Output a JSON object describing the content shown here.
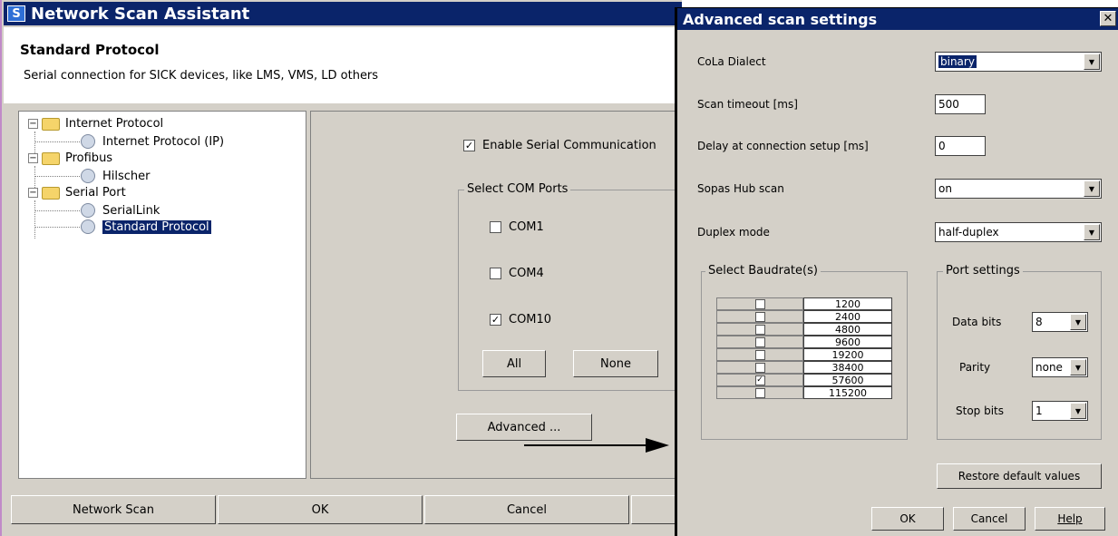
{
  "main_window": {
    "title": "Network Scan Assistant",
    "header_title": "Standard Protocol",
    "header_subtitle": "Serial connection for SICK devices, like LMS, VMS, LD others",
    "tree": {
      "items": [
        {
          "label": "Internet Protocol",
          "level": 0,
          "expanded": true
        },
        {
          "label": "Internet Protocol (IP)",
          "level": 1
        },
        {
          "label": "Profibus",
          "level": 0,
          "expanded": true
        },
        {
          "label": "Hilscher",
          "level": 1
        },
        {
          "label": "Serial Port",
          "level": 0,
          "expanded": true
        },
        {
          "label": "SerialLink",
          "level": 1
        },
        {
          "label": "Standard Protocol",
          "level": 1,
          "selected": true
        }
      ]
    },
    "enable_serial_label": "Enable Serial Communication",
    "enable_serial_checked": true,
    "com_ports": {
      "group_title": "Select COM Ports",
      "ports": [
        {
          "label": "COM1",
          "checked": false
        },
        {
          "label": "COM4",
          "checked": false
        },
        {
          "label": "COM10",
          "checked": true
        }
      ],
      "all_label": "All",
      "none_label": "None"
    },
    "advanced_label": "Advanced ...",
    "buttons": {
      "network_scan": "Network Scan",
      "ok": "OK",
      "cancel": "Cancel"
    }
  },
  "advanced_dialog": {
    "title": "Advanced scan settings",
    "close": "✕",
    "cola_dialect_label": "CoLa Dialect",
    "cola_dialect_value": "binary",
    "scan_timeout_label": "Scan timeout [ms]",
    "scan_timeout_value": "500",
    "delay_label": "Delay at connection setup [ms]",
    "delay_value": "0",
    "sopas_hub_label": "Sopas Hub scan",
    "sopas_hub_value": "on",
    "duplex_label": "Duplex mode",
    "duplex_value": "half-duplex",
    "baudrate": {
      "group_title": "Select Baudrate(s)",
      "rows": [
        {
          "rate": "1200",
          "checked": false
        },
        {
          "rate": "2400",
          "checked": false
        },
        {
          "rate": "4800",
          "checked": false
        },
        {
          "rate": "9600",
          "checked": false
        },
        {
          "rate": "19200",
          "checked": false
        },
        {
          "rate": "38400",
          "checked": false
        },
        {
          "rate": "57600",
          "checked": true
        },
        {
          "rate": "115200",
          "checked": false
        }
      ]
    },
    "port_settings": {
      "group_title": "Port settings",
      "data_bits_label": "Data bits",
      "data_bits_value": "8",
      "parity_label": "Parity",
      "parity_value": "none",
      "stop_bits_label": "Stop bits",
      "stop_bits_value": "1"
    },
    "restore_label": "Restore default values",
    "ok_label": "OK",
    "cancel_label": "Cancel",
    "help_label": "Help"
  },
  "colors": {
    "titlebar": "#0a246a",
    "dialog_bg": "#d4d0c8",
    "selection": "#0a246a"
  }
}
